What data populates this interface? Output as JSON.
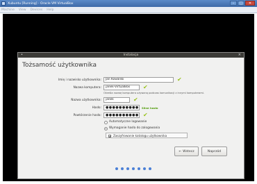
{
  "window": {
    "title": "Xubuntu [Running] - Oracle VM VirtualBox",
    "menu": [
      "Machine",
      "View",
      "Devices",
      "Help"
    ],
    "buttons": {
      "minimize": "–",
      "maximize": "□",
      "close": "✕"
    }
  },
  "installer": {
    "dialog_title": "Instalacja",
    "heading": "Tożsamość użytkownika",
    "fields": {
      "full_name": {
        "label": "Imię i nazwisko użytkownika:",
        "value": "Jan Kowalski"
      },
      "computer_name": {
        "label": "Nazwa komputera:",
        "value": "janek-VirtualBox",
        "hint": "Określa nazwę komputera używaną podczas komunikacji z innymi komputerami."
      },
      "username": {
        "label": "Nazwa użytkownika:",
        "value": "janek"
      },
      "password": {
        "label": "Hasło:",
        "value": "●●●●●●●●●●●●",
        "strength": "Silne hasło"
      },
      "confirm_password": {
        "label": "Powtórzenie hasła:",
        "value": "●●●●●●●●●●●●"
      }
    },
    "options": {
      "auto_login": "Automatyczne logowanie",
      "require_password": "Wymaganie hasła do zalogowania",
      "encrypt_home": "Zaszyfrowanie katalogu użytkownika"
    },
    "buttons": {
      "back": "Wstecz",
      "next": "Naprzód"
    },
    "progress": {
      "total_steps": 7
    },
    "icons": {
      "check": "✔",
      "back_arrow": "←"
    },
    "colors": {
      "check": "#9ac21f",
      "strength": "#4e9a06",
      "dots": "#4a7fd6"
    }
  }
}
